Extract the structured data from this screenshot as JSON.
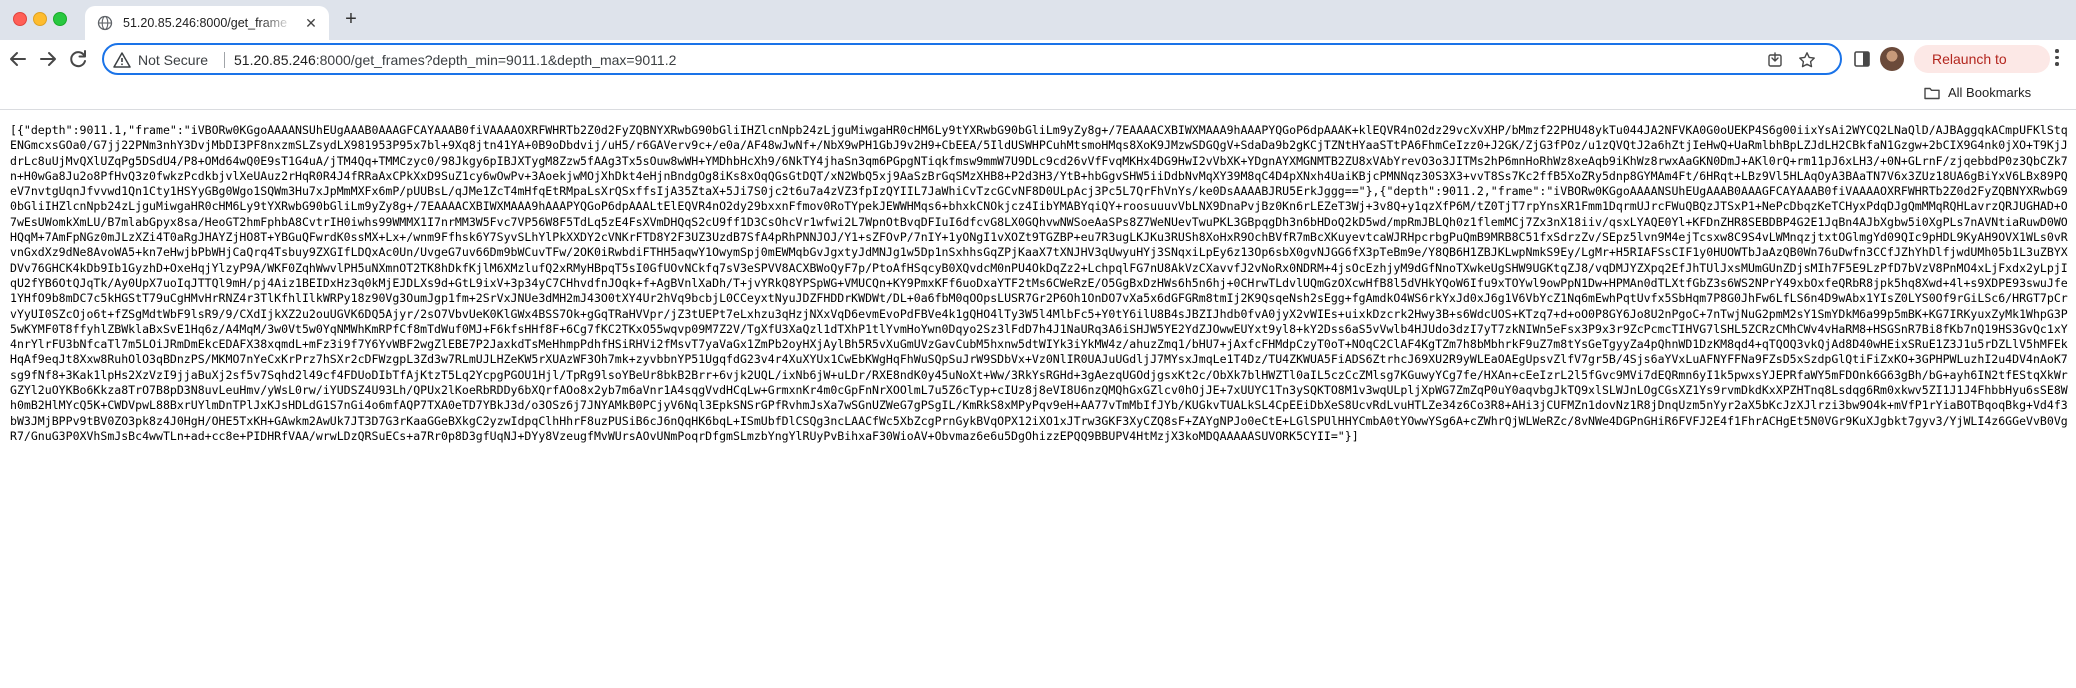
{
  "window": {
    "tab": {
      "title": "51.20.85.246:8000/get_frame",
      "favicon": "globe-icon"
    }
  },
  "toolbar": {
    "security_label": "Not Secure",
    "url_host": "51.20.85.246",
    "url_rest": ":8000/get_frames?depth_min=9011.1&depth_max=9011.2",
    "relaunch_label": "Relaunch to update"
  },
  "bookmarks": {
    "all_label": "All Bookmarks"
  },
  "page": {
    "body_text": "[{\"depth\":9011.1,\"frame\":\"iVBORw0KGgoAAAANSUhEUgAAAB0AAAGFCAYAAAB0fiVAAAAOXRFWHRTb2Z0d2FyZQBNYXRwbG90bGliIHZlcnNpb24zLjguMiwgaHR0cHM6Ly9tYXRwbG90bGliLm9yZy8g+/7EAAAACXBIWXMAAA9hAAAPYQGoP6dpAAAK+klEQVR4nO2dz29vcXvXHP/bMmzf22PHU48ykTu044JA2NFVKA0G0oUEKP4S6g00iixYsAi2WYCQ2LNaQlD/AJBAggqkACmpUFKlStqENGmcxsGOa0/G7jj22PNm3nhY3DvjMbDI3PF8nxzmSLZsydLX981953P95x7bl+9Xq8jtn41YA+0B9oDbdvij/uH5/r6GAVerv9c+/e0a/AF48wJwNf+/NbX9wPH1GbJ9v2H9+CbEEA/5IldUSWHPCuhMtsmoHMqs8XoK9JMzwSDGQgV+SdaDa9b2gKCjTZNtHYaaSTtPA6FhmCeIzz0+J2GK/ZjG3fPOz/u1zQVQtJ2a6hZtjIeHwQ+UaRmlbhBpLZJdLH2CBkfaN1Gzgw+2bCIX9G4nk0jXO+T9KjJdrLc8uUjMvQXlUZqPg5DSdU4/P8+OMd64wQ0E9sT1G4uA/jTM4Qq+TMMCzyc0/98Jkgy6pIBJXTygM8Zzw5fAAg3Tx5sOuw8wWH+YMDhbHcXh9/6NkTY4jhaSn3qm6PGpgNTiqkfmsw9mmW7U9DLc9cd26vVfFvqMKHx4DG9HwI2vVbXK+YDgnAYXMGNMTB2ZU8xVAbYrevO3o3JITMs2hP6mnHoRhWz8xeAqb9iKhWz8rwxAaGKN0DmJ+AKl0rQ+rm11pJ6xLH3/+0N+GLrnF/zjqebbdP0z3QbCZk7n+H0wGa8Ju2o8PfHvQ3z0fwkzPcdkbjvlXeUAuz2rHqR0R4J4fRRaAxCPkXxD9SuZ1cy6wOwPv+3AoekjwMOjXhDkt4eHjnBndgOg8iKs8xOqQGsGtDQT/xN2WbQ5xj9AaSzBrGqSMzXHB8+P2d3H3/YtB+hbGgvSHW5iiDdbNvMqXY39M8qC4D4pXNxh4UaiKBjcPMNNqz30S3X3+vvT8Ss7Kc2ffB5XoZRy5dnp8GYMAm4Ft/6HRqt+LBz9Vl5HLAqOyA3BAaTN7V6x3ZUz18UA6gBiYxV6LBx89PQeV7nvtgUqnJfvvwd1Qn1Cty1HSYyGBg0Wgo1SQWm3Hu7xJpMmMXFx6mP/pUUBsL/qJMe1ZcT4mHfqEtRMpaLsXrQSxffsIjA35ZtaX+5Ji7S0jc2t6u7a4zVZ3fpIzQYIIL7JaWhiCvTzcGCvNF8D0ULpAcj3Pc5L7QrFhVnYs/ke0DsAAAABJRU5ErkJggg==\"},{\"depth\":9011.2,\"frame\":\"iVBORw0KGgoAAAANSUhEUgAAAB0AAAGFCAYAAAB0fiVAAAAOXRFWHRTb2Z0d2FyZQBNYXRwbG90bGliIHZlcnNpb24zLjguMiwgaHR0cHM6Ly9tYXRwbG90bGliLm9yZy8g+/7EAAAACXBIWXMAAA9hAAAPYQGoP6dpAAALtElEQVR4nO2dy29bxxnFfmov0RoTYpekJEWWHMqs6+bhxkCNOkjcz4IibYMABYqiQY+roosuuuvVbLNX9DnaPvjBz0Kn6rLEZeT3Wj+3v8Q+y1qzXfP6M/tZ0TjT7rpYnsXR1Fmm1DqrmUJrcFWuQBQzJTSxP1+NePcDbqzKeTCHyxPdqDJgQmMMqRQHLavrzQRJUGHAD+O7wEsUWomkXmLU/B7mlabGpyx8sa/HeoGT2hmFphbA8CvtrIH0iwhs99WMMX1I7nrMM3W5Fvc7VP56W8F5TdLq5zE4FsXVmDHQqS2cU9ff1D3CsOhcVr1wfwi2L7WpnOtBvqDFIuI6dfcvG8LX0GQhvwNWSoeAaSPs8Z7WeNUevTwuPKL3GBpqgDh3n6bHDoQ2kD5wd/mpRmJBLQh0z1flemMCj7Zx3nX18iiv/qsxLYAQE0Yl+KFDnZHR8SEBDBP4G2E1JqBn4AJbXgbw5i0XgPLs7nAVNtiaRuwD0WOHQqM+7AmFpNGz0mJLzXZi4T0aRgJHAYZjHO8T+YBGuQFwrdK0ssMX+Lx+/wnm9Ffhsk6Y7SyvSLhYlPkXXDY2cVNKrFTD8Y2F3UZ3UzdB7SfA4pRhPNNJOJ/Y1+sZFOvP/7nIY+1yONgI1vXOZt9TGZBP+eu7R3ugLKJKu3RUSh8XoHxR9OchBVfR7mBcXKuyevtcaWJRHpcrbgPuQmB9MRB8C51fxSdrzZv/SEpz5lvn9M4ejTcsxw8C9S4vLWMnqzjtxtOGlmgYd09QIc9pHDL9KyAH9OVX1WLs0vRvnGxdXz9dNe8AvoWA5+kn7eHwjbPbWHjCaQrq4Tsbuy9ZXGIfLDQxAc0Un/UvgeG7uv66Dm9bWCuvTFw/2OK0iRwbdiFTHH5aqwY1OwymSpj0mEWMqbGvJgxtyJdMNJg1w5Dp1nSxhhsGqZPjKaaX7tXNJHV3qUwyuHYj3SNqxiLpEy6z13Op6sbX0gvNJGG6fX3pTeBm9e/Y8QB6H1ZBJKLwpNmkS9Ey/LgMr+H5RIAFSsCIF1y0HUOWTbJaAzQB0Wn76uDwfn3CCfJZhYhDlfjwdUMh05b1L3uZBYXDVv76GHCK4kDb9Ib1GyzhD+OxeHqjYlzyP9A/WKF0ZqhWwvlPH5uNXmnOT2TK8hDkfKjlM6XMzlufQ2xRMyHBpqT5sI0GfUOvNCkfq7sV3eSPVV8ACXBWoQyF7p/PtoAfHSqcyB0XQvdcM0nPU4OkDqZz2+LchpqlFG7nU8AkVzCXavvfJ2vNoRx0NDRM+4jsOcEzhjyM9dGfNnoTXwkeUgSHW9UGKtqZJ8/vqDMJYZXpq2EfJhTUlJxsMUmGUnZDjsMIh7F5E9LzPfD7bVzV8PnMO4xLjFxdx2yLpjIqU2fYB6OtQJqTk/Ay0UpX7uoIqJTTQl9mH/pj4Aiz1BEIDxHz3q0kMjEJDLXs9d+GtL9ixV+3p34yC7CHhvdfnJOqk+f+AgBVnlXaDh/T+jvYRkQ8YPSpWG+VMUCQn+KY9PmxKFf6uoDxaYTF2tMs6CWeRzE/O5GgBxDzHWs6h5n6hj+0CHrwTLdvlUQmGzOXcwHfB8l5dVHkYQoW6Ifu9xTOYwl9owPpN1Dw+HPMAn0dTLXtfGbZ3s6WS2NPrY49xbOxfeQRbR8jpk5hq8Xwd+4l+s9XDPE93swuJfe1YHfO9b8mDC7c5kHGStT79uCgHMvHrRNZ4r3TlKfhlIlkWRPy18z90Vg3OumJgp1fm+2SrVxJNUe3dMH2mJ43O0tXY4Ur2hVq9bcbjL0CCeyxtNyuJDZFHDDrKWDWt/DL+0a6fbM0qOOpsLUSR7Gr2P6Oh1OnDO7vXa5x6dGFGRm8tmIj2K9QsqeNsh2sEgg+fgAmdkO4WS6rkYxJd0xJ6g1V6VbYcZ1Nq6mEwhPqtUvfx5SbHqm7P8G0JhFw6LfLS6n4D9wAbx1YIsZ0LYS0Of9rGiLSc6/HRGT7pCrvYyUI0SZcOjo6t+fZSgMdtWbF9lsR9/9/CXdIjkXZ2u2ouUGVK6DQ5Ajyr/2sO7VbvUeK0KlGWx4BSS7Ok+gGqTRaHVVpr/jZ3tUEPt7eLxhzu3qHzjNXxVqD6evmEvoPdFBVe4k1gQHO4lTy3W5l4MlbFc5+Y0tY6ilU8B4sJBZIJhdb0fvA0jyX2vWIEs+uixkDzcrk2Hwy3B+s6WdcUOS+KTzq7+d+oO0P8GY6Jo8U2nPgoC+7nTwjNuG2pmM2sY1SmYDkM6a99p5mBK+KG7IRKyuxZyMk1WhpG3P5wKYMF0T8ffyhlZBWklaBxSvE1Hq6z/A4MqM/3w0Vt5w0YqNMWhKmRPfCf8mTdWuf0MJ+F6kfsHHf8F+6Cg7fKC2TKxO55wqvp09M7Z2V/TgXfU3XaQzl1dTXhP1tlYvmHoYwn0Dqyo2Sz3lFdD7h4J1NaURq3A6iSHJW5YE2YdZJOwwEUYxt9yl8+kY2Dss6aS5vVwlb4HJUdo3dzI7yT7zkNIWn5eFsx3P9x3r9ZcPcmcTIHVG7lSHL5ZCRzCMhCWv4vHaRM8+HSGSnR7Bi8fKb7nQ19HS3GvQc1xY4nrYlrFU3bNfcaTl7m5LOiJRmDmEkcEDAFX38xqmdL+mFz3i9f7Y6YvWBF2wgZlEBE7P2JaxkdTsMeHhmpPdhfHSiRHVi2fMsvT7yaVaGx1ZmPb2oyHXjAylBh5R5vXuGmUVzGavCubM5hxnw5dtWIYk3iYkMW4z/ahuzZmq1/bHU7+jAxfcFHMdpCzyT0oT+NOqC2ClAF4KgTZm7h8bMbhrkF9uZ7m8tYsGeTgyyZa4pQhnWD1DzKM8qd4+qTQOQ3vkQjAd8D40wHEixSRuE1Z3J1u5rDZLlV5hMFEkHqAf9eqJt8Xxw8RuhOlO3qBDnzPS/MKMO7nYeCxKrPrz7hSXr2cDFWzgpL3Zd3w7RLmUJLHZeKW5rXUAzWF3Oh7mk+zyvbbnYP51UgqfdG23v4r4XuXYUx1CwEbKWgHqFhWuSQpSuJrW9SDbVx+Vz0NlIR0UAJuUGdljJ7MYsxJmqLe1T4Dz/TU4ZKWUA5FiADS6ZtrhcJ69XU2R9yWLEaOAEgUpsvZlfV7gr5B/4Sjs6aYVxLuAFNYFFNa9FZsD5xSzdpGlQtiFiZxKO+3GPHPWLuzhI2u4DV4nAoK7sg9fNf8+3Kak1lpHs2XzVzI9jjaBuXj2sf5v7Sqhd2l49cf4FDUoDIbTfAjKtzT5Lq2YcpgPGOU1Hjl/TpRg9lsoYBeUr8bkB2Brr+6vjk2UQL/ixNb6jW+uLDr/RXE8ndK0y45uNoXt+Ww/3RkYsRGHd+3gAezqUGOdjgsxKt2c/ObXk7blHWZTl0aIL5czCcZMlsg7KGuwyYCg7fe/HXAn+cEeIzrL2l5fGvc9MVi7dEQRmn6yI1k5pwxsYJEPRfaWY5mFDOnk6G63gBh/bG+ayh6IN2tfEStqXkWrGZYl2uOYKBo6Kkza8TrO7B8pD3N8uvLeuHmv/yWsL0rw/iYUDSZ4U93Lh/QPUx2lKoeRbRDDy6bXQrfAOo8x2yb7m6aVnr1A4sqgVvdHCqLw+GrmxnKr4m0cGpFnNrXOOlmL7u5Z6cTyp+cIUz8j8eVI8U6nzQMQhGxGZlcv0hOjJE+7xUUYC1Tn3ySQKTO8M1v3wqULpljXpWG7ZmZqP0uY0aqvbgJkTQ9xlSLWJnLOgCGsXZ1Ys9rvmDkdKxXPZHTnq8Lsdqg6Rm0xkwv5ZI1J1J4FhbbHyu6sSE8Wh0mB2HlMYcQ5K+CWDVpwL88BxrUYlmDnTPlJxKJsHDLdG1S7nGi4o6mfAQP7TXA0eTD7YBkJ3d/o3OSz6j7JNYAMkB0PCjyV6Nql3EpkSNSrGPfRvhmJsXa7wSGnUZWeG7gPSgIL/KmRkS8xMPyPqv9eH+AA77vTmMbIfJYb/KUGkvTUALkSL4CpEEiDbXeS8UcvRdLvuHTLZe34z6Co3R8+AHi3jCUFMZn1dovNz1R8jDnqUzm5nYyr2aX5bKcJzXJlrzi3bw9O4k+mVfP1rYiaBOTBqoqBkg+Vd4f3bW3JMjBPPv9tBV0ZO3pk8z4J0HgH/OHE5TxKH+GAwkm2AwUk7JT3D7G3rKaaGGeBXkgC2yzwIdpqClhHhrF8uzPUSiB6cJ6nQqHK6bqL+ISmUbfDlCSQg3ncLAACfWc5XbZcgPrnGykBVqOPX12iXO1xJTrw3GKF3XyCZQ8sF+ZAYgNPJo0eCtE+LGlSPUlHHYCmbA0tYOwwYSg6A+cZWhrQjWLWeRZc/8vNWe4DGPnGHiR6FVFJ2E4f1FhrACHgEt5N0VGr9KuXJgbkt7gyv3/YjWLI4z6GGeVvB0VgR7/GnuG3P0XVhSmJsBc4wwTLn+ad+cc8e+PIDHRfVAA/wrwLDzQRSuECs+a7Rr0p8D3gfUqNJ+DYy8VzeugfMvWUrsAOvUNmPoqrDfgmSLmzbYngYlRUyPvBihxaF30WioAV+Obvmaz6e6u5DgOhizzEPQQ9BBUPV4HtMzjX3koMDQAAAAASUVORK5CYII=\"}]"
  }
}
